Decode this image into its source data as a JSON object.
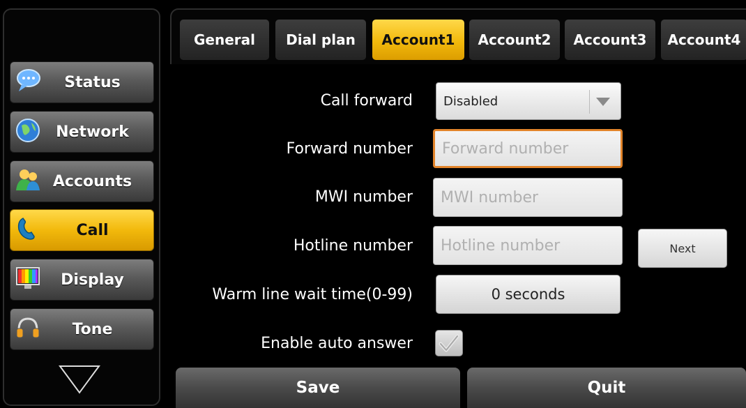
{
  "sidebar": {
    "items": [
      {
        "label": "Status",
        "icon": "chat-bubble-icon"
      },
      {
        "label": "Network",
        "icon": "globe-icon"
      },
      {
        "label": "Accounts",
        "icon": "users-icon"
      },
      {
        "label": "Call",
        "icon": "phone-handset-icon",
        "active": true
      },
      {
        "label": "Display",
        "icon": "monitor-icon"
      },
      {
        "label": "Tone",
        "icon": "headphones-icon"
      }
    ],
    "more_icon": "triangle-down-icon"
  },
  "tabs": [
    {
      "label": "General"
    },
    {
      "label": "Dial plan"
    },
    {
      "label": "Account1",
      "active": true
    },
    {
      "label": "Account2"
    },
    {
      "label": "Account3"
    },
    {
      "label": "Account4"
    }
  ],
  "form": {
    "call_forward": {
      "label": "Call forward",
      "value": "Disabled"
    },
    "forward_number": {
      "label": "Forward number",
      "placeholder": "Forward number"
    },
    "mwi_number": {
      "label": "MWI number",
      "placeholder": "MWI number"
    },
    "hotline_number": {
      "label": "Hotline number",
      "placeholder": "Hotline number",
      "next_label": "Next"
    },
    "warm_line": {
      "label": "Warm line wait time(0-99)",
      "value": "0 seconds"
    },
    "auto_answer": {
      "label": "Enable auto answer",
      "checked": true
    }
  },
  "actions": {
    "save_label": "Save",
    "quit_label": "Quit"
  },
  "colors": {
    "accent": "#f2b90c",
    "focus": "#e2842a"
  }
}
